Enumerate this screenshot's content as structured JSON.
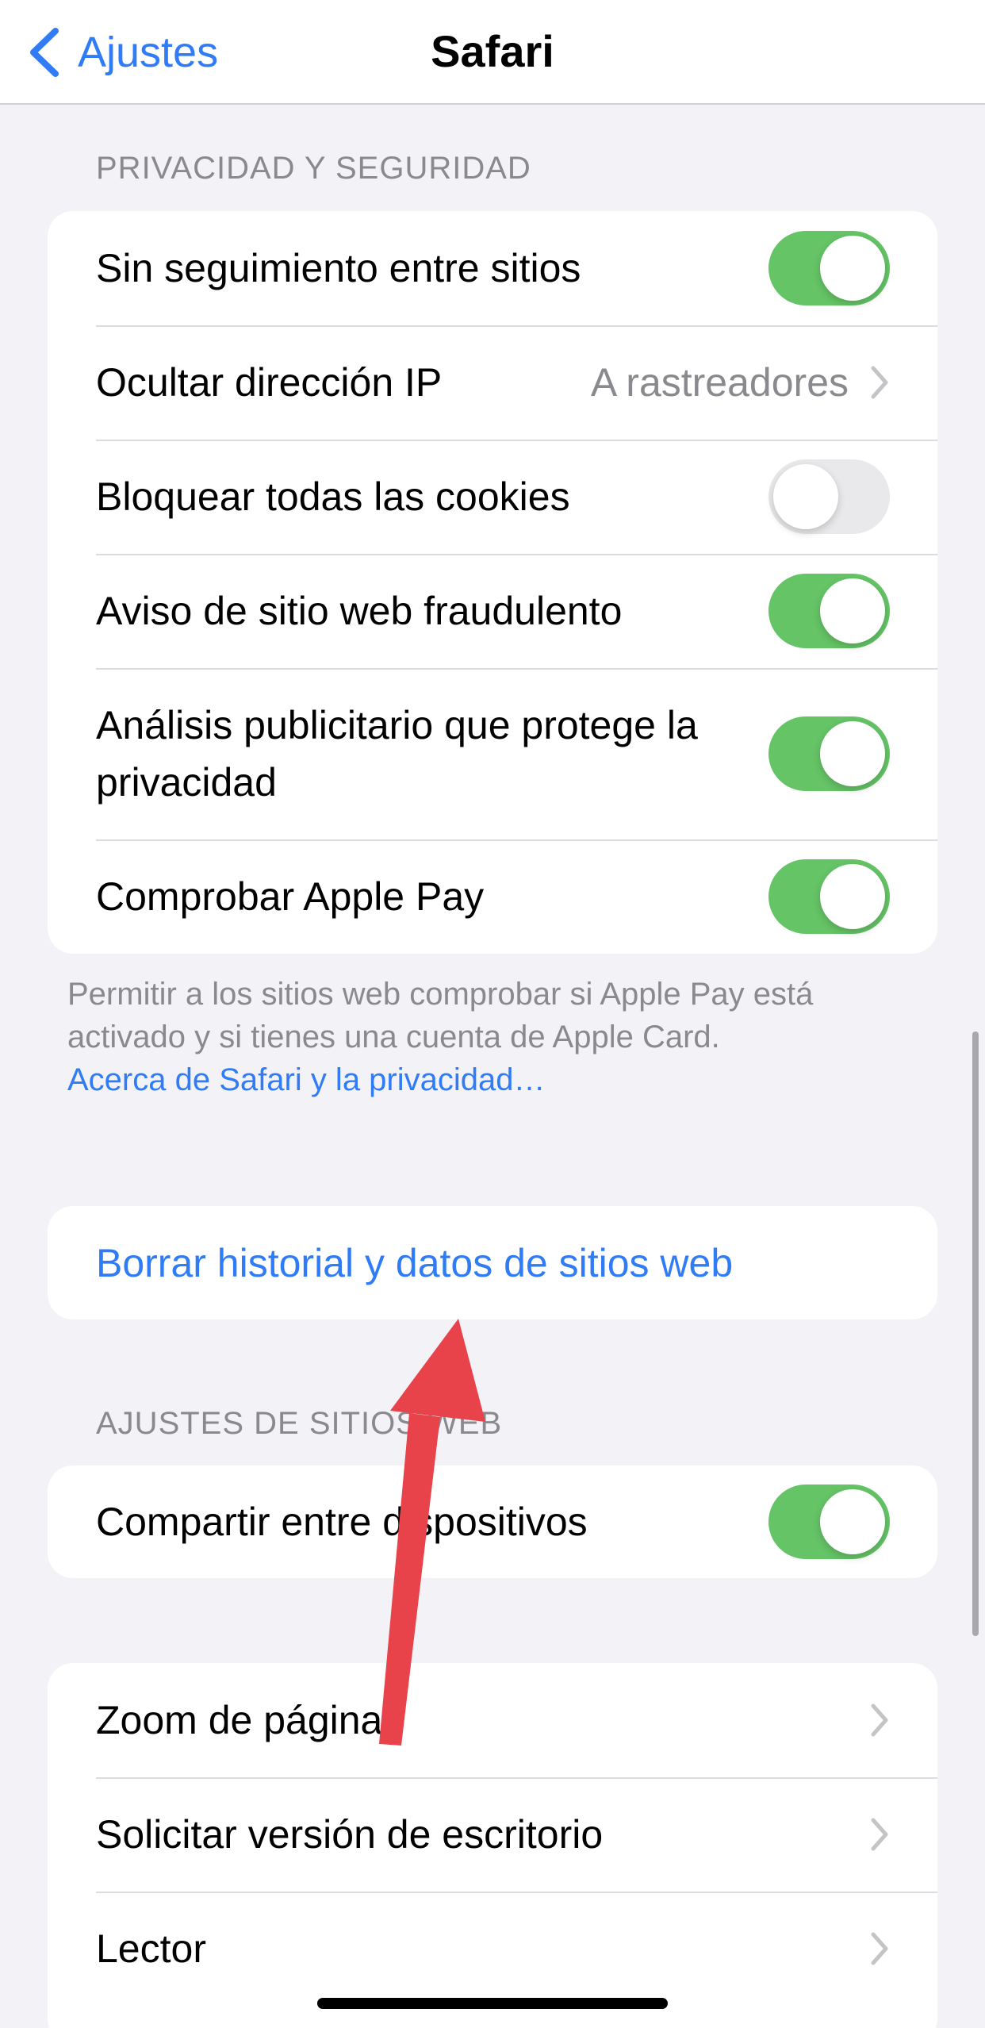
{
  "nav": {
    "back_label": "Ajustes",
    "title": "Safari"
  },
  "privacy": {
    "header": "PRIVACIDAD Y SEGURIDAD",
    "rows": [
      {
        "label": "Sin seguimiento entre sitios",
        "toggle": "on"
      },
      {
        "label": "Ocultar dirección IP",
        "value": "A rastreadores"
      },
      {
        "label": "Bloquear todas las cookies",
        "toggle": "off"
      },
      {
        "label": "Aviso de sitio web fraudulento",
        "toggle": "on"
      },
      {
        "label": "Análisis publicitario que protege la privacidad",
        "toggle": "on"
      },
      {
        "label": "Comprobar Apple Pay",
        "toggle": "on"
      }
    ],
    "footer": "Permitir a los sitios web comprobar si Apple Pay está activado y si tienes una cuenta de Apple Card.",
    "footer_link": "Acerca de Safari y la privacidad…"
  },
  "clear_action": "Borrar historial y datos de sitios web",
  "website_settings": {
    "header": "AJUSTES DE SITIOS WEB",
    "rows": [
      {
        "label": "Compartir entre dispositivos",
        "toggle": "on"
      }
    ]
  },
  "more": {
    "rows": [
      {
        "label": "Zoom de página"
      },
      {
        "label": "Solicitar versión de escritorio"
      },
      {
        "label": "Lector"
      }
    ]
  },
  "colors": {
    "accent": "#2f7cf6",
    "toggle_on": "#65c466",
    "annotation_arrow": "#e8424a"
  }
}
